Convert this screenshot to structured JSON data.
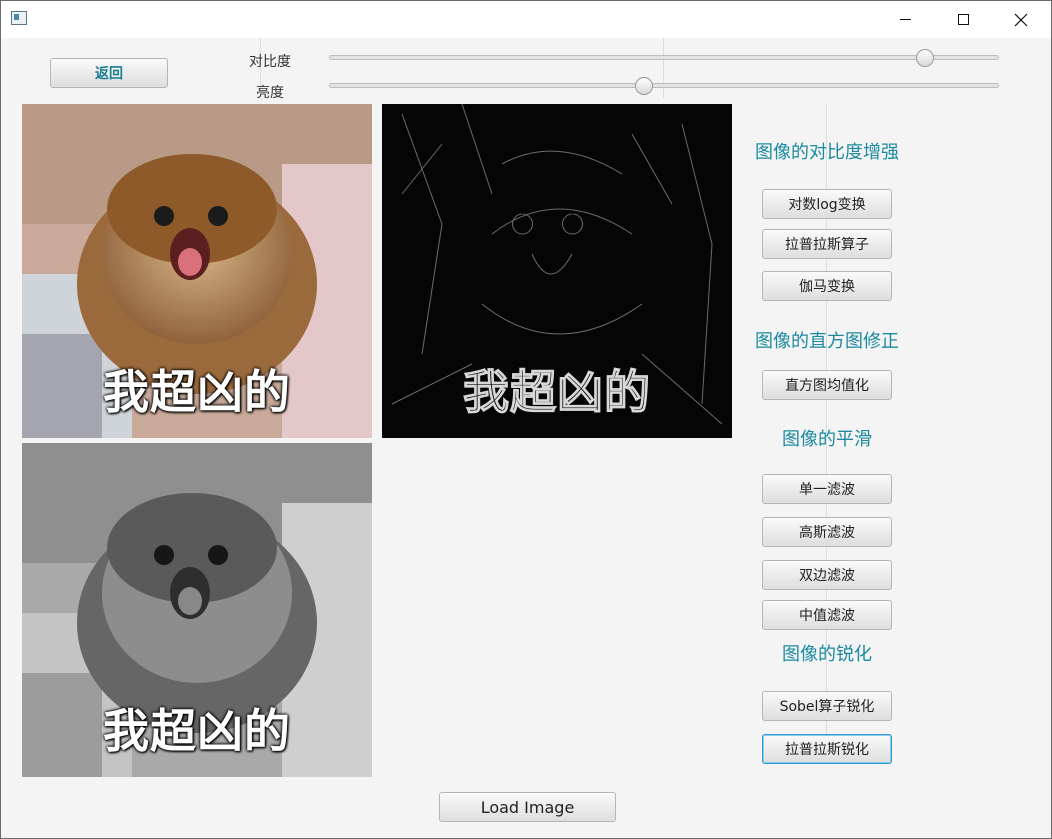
{
  "window": {
    "icon": "app-window-icon"
  },
  "toolbar": {
    "back_label": "返回",
    "contrast_label": "对比度",
    "brightness_label": "亮度",
    "contrast_level": 0.89,
    "brightness_level": 0.47
  },
  "images": {
    "original_caption": "我超凶的",
    "edge_caption": "我超凶的",
    "gray_caption": "我超凶的"
  },
  "sidebar": {
    "contrast_title": "图像的对比度增强",
    "log_transform": "对数log变换",
    "laplacian_operator": "拉普拉斯算子",
    "gamma_transform": "伽马变换",
    "histogram_title": "图像的直方图修正",
    "histogram_equalization": "直方图均值化",
    "smoothing_title": "图像的平滑",
    "single_filter": "单一滤波",
    "gaussian_filter": "高斯滤波",
    "bilateral_filter": "双边滤波",
    "median_filter": "中值滤波",
    "sharpening_title": "图像的锐化",
    "sobel_sharpen": "Sobel算子锐化",
    "laplacian_sharpen": "拉普拉斯锐化"
  },
  "footer": {
    "load_label": "Load Image"
  },
  "colors": {
    "accent": "#1b8aa0",
    "focus": "#2d9bd6",
    "background": "#f4f4f4"
  }
}
